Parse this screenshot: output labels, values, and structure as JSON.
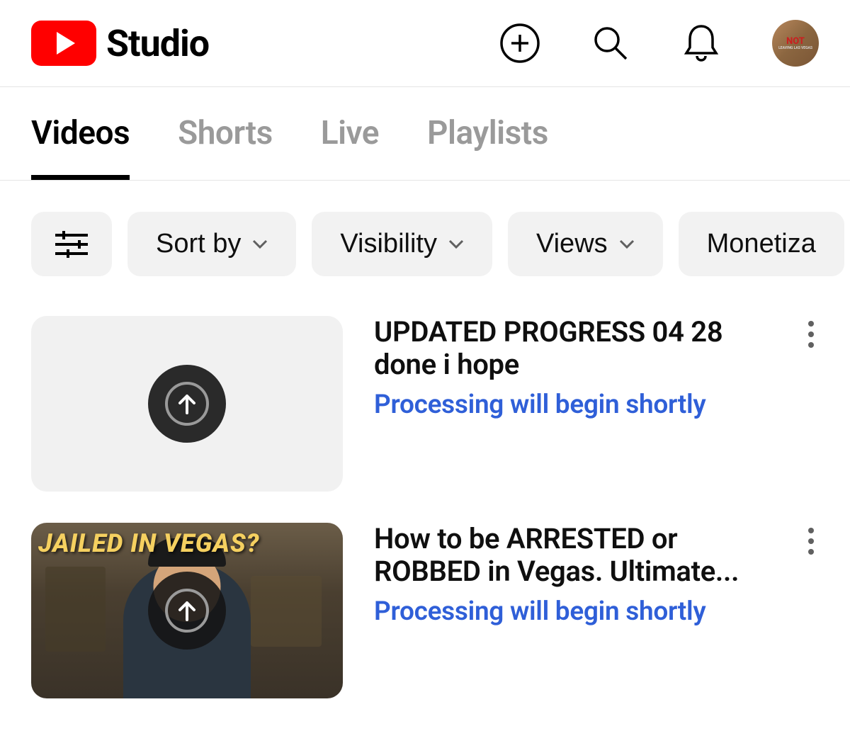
{
  "header": {
    "brand": "Studio",
    "avatar": {
      "top_text": "NOT",
      "bottom_text": "LEAVING LAS VEGAS"
    }
  },
  "tabs": [
    {
      "label": "Videos",
      "active": true
    },
    {
      "label": "Shorts",
      "active": false
    },
    {
      "label": "Live",
      "active": false
    },
    {
      "label": "Playlists",
      "active": false
    }
  ],
  "filters": {
    "sort_by": "Sort by",
    "visibility": "Visibility",
    "views": "Views",
    "monetization": "Monetiza"
  },
  "videos": [
    {
      "title": "UPDATED PROGRESS 04 28 done i hope",
      "status": "Processing will begin shortly",
      "has_thumbnail": false,
      "thumb_text": ""
    },
    {
      "title": "How to be ARRESTED or ROBBED in Vegas. Ultimate...",
      "status": "Processing will begin shortly",
      "has_thumbnail": true,
      "thumb_text": "JAILED IN VEGAS?"
    }
  ]
}
